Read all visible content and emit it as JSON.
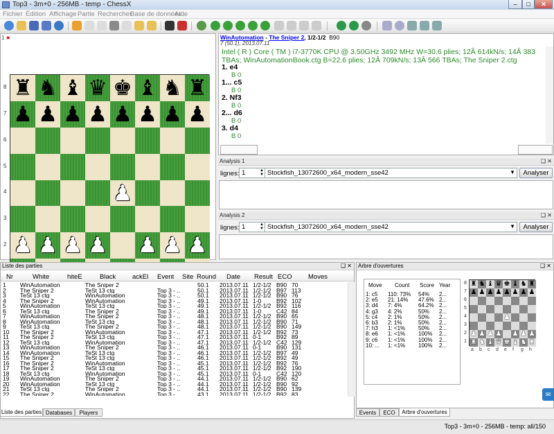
{
  "window": {
    "title": "Top3 - 3m+0 - 256MB - temp - ChessX"
  },
  "menu": [
    "Fichier",
    "Édition",
    "Affichage",
    "Partie",
    "Rechercher",
    "Base de données",
    "Aide"
  ],
  "board_tab": {
    "label": "1"
  },
  "board": {
    "files": [
      "a",
      "b",
      "c",
      "d",
      "e",
      "f",
      "g",
      "h"
    ],
    "ranks": [
      "8",
      "7",
      "6",
      "5",
      "4",
      "3",
      "2",
      "1"
    ],
    "position": [
      [
        "r",
        "n",
        "b",
        "q",
        "k",
        "b",
        "n",
        "r"
      ],
      [
        "p",
        "p",
        "p",
        "p",
        "p",
        "p",
        "p",
        "p"
      ],
      [
        "",
        "",
        "",
        "",
        "",
        "",
        "",
        ""
      ],
      [
        "",
        "",
        "",
        "",
        "",
        "",
        "",
        ""
      ],
      [
        "",
        "",
        "",
        "",
        "P",
        "",
        "",
        ""
      ],
      [
        "",
        "",
        "",
        "",
        "",
        "",
        "",
        ""
      ],
      [
        "P",
        "P",
        "P",
        "P",
        "",
        "P",
        "P",
        "P"
      ],
      [
        "R",
        "N",
        "B",
        "Q",
        "K",
        "B",
        "N",
        "R"
      ]
    ]
  },
  "notation": {
    "white": "WinAutomation",
    "separator": " - ",
    "black": "The Sniper 2",
    "result": ", 1/2-1/2",
    "eco": "B90",
    "subline": "7 (50.1), 2013.07.11",
    "engine_text": "Intel ( R ) Core ( TM ) i7-3770K CPU @ 3.50GHz 3492 MHz W=30.6 plies; 12Â 614kN/s; 14Â 383 TBAs; WinAutomationBook.ctg B=22.6 plies; 12Â 709kN/s; 13Â 566 TBAs; The Sniper 2.ctg",
    "moves": [
      {
        "move": "1. e4",
        "ann": "B 0"
      },
      {
        "move": "1... c5",
        "ann": "B 0"
      },
      {
        "move": "2. Nf3",
        "ann": "B 0"
      },
      {
        "move": "2... d6",
        "ann": "B 0"
      },
      {
        "move": "3. d4",
        "ann": "B 0"
      }
    ]
  },
  "analysis": [
    {
      "title": "Analysis 1",
      "lines_label": "lignes:",
      "lines": "1",
      "engine": "Stockfish_13072600_x64_modern_sse42",
      "button": "Analyser"
    },
    {
      "title": "Analysis 2",
      "lines_label": "lignes:",
      "lines": "1",
      "engine": "Stockfish_13072600_x64_modern_sse42",
      "button": "Analyser"
    }
  ],
  "gamelist": {
    "title": "Liste des parties",
    "columns": [
      "Nr",
      "White",
      "hiteE",
      "Black",
      "ackEl",
      "Event",
      "Site",
      "Round",
      "Date",
      "Result",
      "ECO",
      "Moves"
    ],
    "rows": [
      [
        "1",
        "WinAutomation",
        "",
        "The Sniper 2",
        "",
        "",
        "",
        "50.1",
        "2013.07.11",
        "1/2-1/2",
        "B90",
        "70"
      ],
      [
        "2",
        "The Sniper 2",
        "",
        "TeSt 13 ctg",
        "",
        "Top 3 - ...",
        "",
        "50.1",
        "2013.07.11",
        "1/2-1/2",
        "B97",
        "113"
      ],
      [
        "3",
        "TeSt 13 ctg",
        "",
        "WinAutomation",
        "",
        "Top 3 - ...",
        "",
        "50.1",
        "2013.07.11",
        "1/2-1/2",
        "B90",
        "76"
      ],
      [
        "4",
        "The Sniper 2",
        "",
        "WinAutomation",
        "",
        "Top 3 - ...",
        "",
        "49.1",
        "2013.07.11",
        "1-0",
        "B92",
        "102"
      ],
      [
        "5",
        "WinAutomation",
        "",
        "TeSt 13 ctg",
        "",
        "Top 3 - ...",
        "",
        "49.1",
        "2013.07.11",
        "1/2-1/2",
        "B92",
        "116"
      ],
      [
        "6",
        "TeSt 13 ctg",
        "",
        "The Sniper 2",
        "",
        "Top 3 - ...",
        "",
        "49.1",
        "2013.07.11",
        "1-0",
        "C42",
        "84"
      ],
      [
        "7",
        "WinAutomation",
        "",
        "The Sniper 2",
        "",
        "Top 3 - ...",
        "",
        "48.1",
        "2013.07.11",
        "1/2-1/2",
        "B90",
        "65"
      ],
      [
        "8",
        "WinAutomation",
        "",
        "TeSt 13 ctg",
        "",
        "Top 3 - ...",
        "",
        "48.1",
        "2013.07.11",
        "1/2-1/2",
        "B90",
        "71"
      ],
      [
        "9",
        "TeSt 13 ctg",
        "",
        "The Sniper 2",
        "",
        "Top 3 - ...",
        "",
        "48.1",
        "2013.07.11",
        "1/2-1/2",
        "B90",
        "149"
      ],
      [
        "10",
        "The Sniper 2",
        "",
        "WinAutomation",
        "",
        "Top 3 - ...",
        "",
        "47.1",
        "2013.07.11",
        "1/2-1/2",
        "B92",
        "73"
      ],
      [
        "11",
        "The Sniper 2",
        "",
        "TeSt 13 ctg",
        "",
        "Top 3 - ...",
        "",
        "47.1",
        "2013.07.11",
        "0-1",
        "B92",
        "89"
      ],
      [
        "12",
        "TeSt 13 ctg",
        "",
        "WinAutomation",
        "",
        "Top 3 - ...",
        "",
        "47.1",
        "2013.07.11",
        "1/2-1/2",
        "C42",
        "129"
      ],
      [
        "13",
        "WinAutomation",
        "",
        "The Sniper 2",
        "",
        "Top 3 - ...",
        "",
        "46.1",
        "2013.07.11",
        "0-1",
        "B90",
        "131"
      ],
      [
        "14",
        "WinAutomation",
        "",
        "TeSt 13 ctg",
        "",
        "Top 3 - ...",
        "",
        "46.1",
        "2013.07.11",
        "1/2-1/2",
        "B97",
        "49"
      ],
      [
        "15",
        "The Sniper 2",
        "",
        "TeSt 13 ctg",
        "",
        "Top 3 - ...",
        "",
        "46.1",
        "2013.07.11",
        "1/2-1/2",
        "B92",
        "49"
      ],
      [
        "16",
        "The Sniper 2",
        "",
        "WinAutomation",
        "",
        "Top 3 - ...",
        "",
        "45.1",
        "2013.07.11",
        "1/2-1/2",
        "B92",
        "76"
      ],
      [
        "17",
        "The Sniper 2",
        "",
        "TeSt 13 ctg",
        "",
        "Top 3 - ...",
        "",
        "45.1",
        "2013.07.11",
        "1/2-1/2",
        "B92",
        "190"
      ],
      [
        "18",
        "TeSt 13 ctg",
        "",
        "WinAutomation",
        "",
        "Top 3 - ...",
        "",
        "45.1",
        "2013.07.11",
        "0-1",
        "C42",
        "120"
      ],
      [
        "19",
        "WinAutomation",
        "",
        "The Sniper 2",
        "",
        "Top 3 - ...",
        "",
        "44.1",
        "2013.07.11",
        "1/2-1/2",
        "B90",
        "62"
      ],
      [
        "20",
        "WinAutomation",
        "",
        "TeSt 13 ctg",
        "",
        "Top 3 - ...",
        "",
        "44.1",
        "2013.07.11",
        "1/2-1/2",
        "B90",
        "92"
      ],
      [
        "21",
        "TeSt 13 ctg",
        "",
        "The Sniper 2",
        "",
        "Top 3 - ...",
        "",
        "44.1",
        "2013.07.11",
        "1/2-1/2",
        "B90",
        "139"
      ],
      [
        "22",
        "The Sniper 2",
        "",
        "WinAutomation",
        "",
        "Top 3 - ...",
        "",
        "43.1",
        "2013.07.11",
        "1/2-1/2",
        "B92",
        "83"
      ]
    ],
    "tabs": [
      "Liste des parties",
      "Databases",
      "Players"
    ]
  },
  "tree": {
    "title": "Arbre d'ouvertures",
    "columns": [
      "Move",
      "Count",
      "Score",
      "Year"
    ],
    "rows": [
      [
        "1: c5",
        "110: 73%",
        "54%",
        "2..."
      ],
      [
        "2: e5",
        "21: 14%",
        "47.6%",
        "2..."
      ],
      [
        "3: d4",
        "7: 4%",
        "64.2%",
        "2..."
      ],
      [
        "4: g3",
        "4: 2%",
        "50%",
        "2..."
      ],
      [
        "5: c4",
        "2: 1%",
        "50%",
        "2..."
      ],
      [
        "6: b3",
        "2: 1%",
        "50%",
        "2..."
      ],
      [
        "7: h3",
        "1: <1%",
        "50%",
        "2..."
      ],
      [
        "8: e6",
        "1: <1%",
        "100%",
        "2..."
      ],
      [
        "9: c6",
        "1: <1%",
        "100%",
        "2..."
      ],
      [
        "10: ...",
        "1: <1%",
        "100%",
        "2..."
      ]
    ],
    "tabs": [
      "Events",
      "ECO",
      "Arbre d'ouvertures"
    ]
  },
  "status": {
    "text": "Top3 - 3m+0 - 256MB - temp: all/150"
  },
  "colors": {
    "dark_square": "#3e9a36",
    "light_square": "#efe5c8",
    "engine_text": "#2a8a2a",
    "link": "#0000ff"
  }
}
